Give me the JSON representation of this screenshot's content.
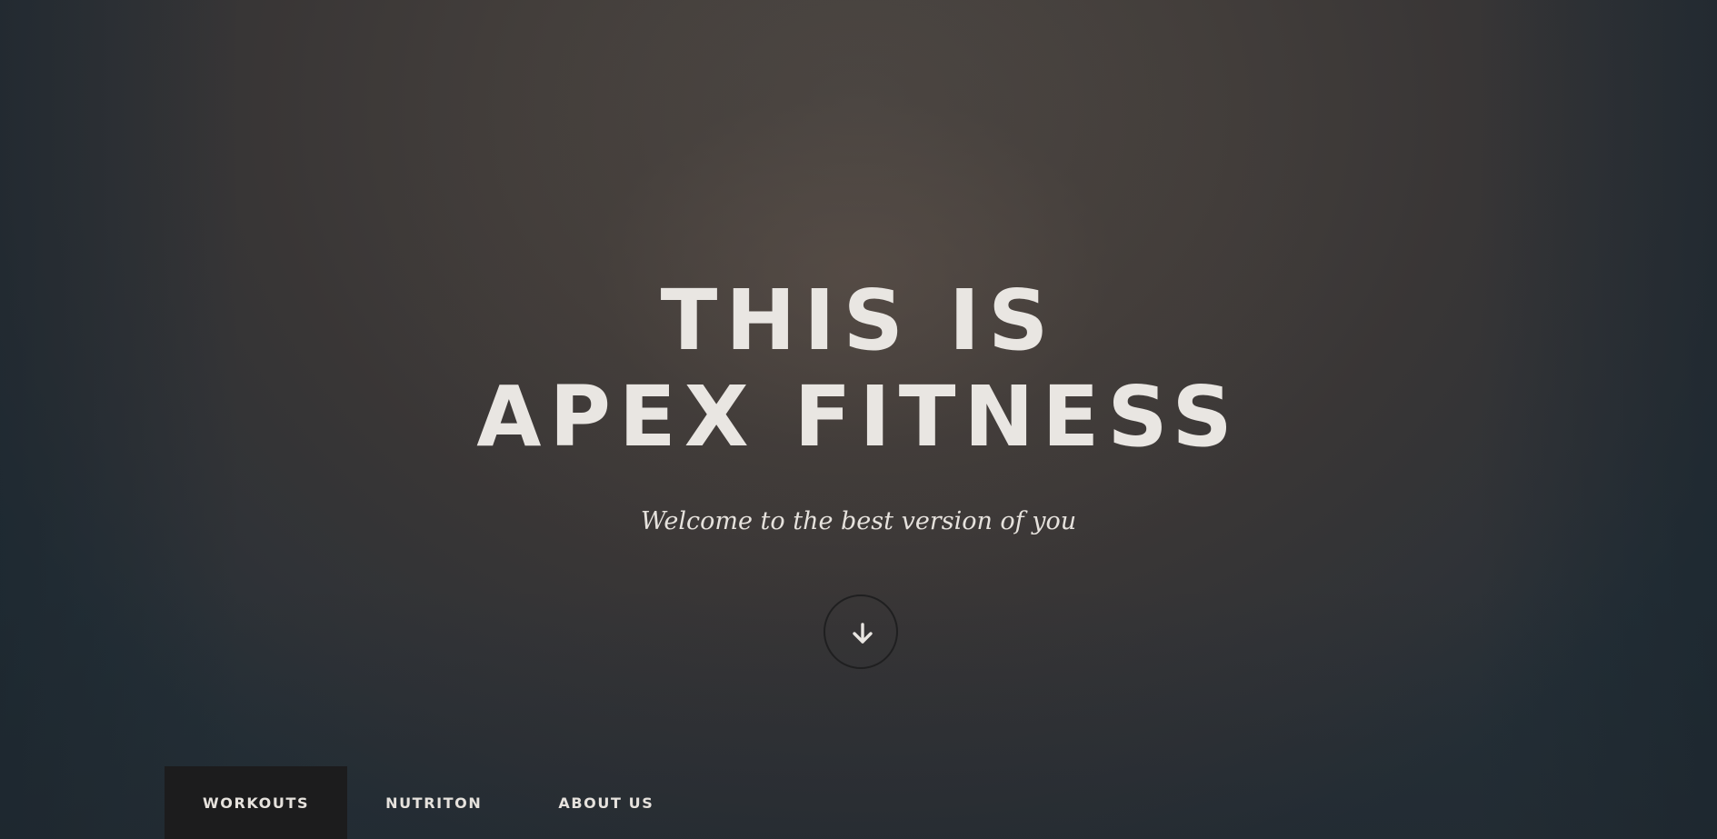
{
  "hero": {
    "title_line_1": "THIS IS",
    "title_line_2": "APEX FITNESS",
    "tagline": "Welcome to the best version of you",
    "scroll_icon": "arrow-down-icon"
  },
  "nav": {
    "items": [
      {
        "label": "WORKOUTS",
        "active": true
      },
      {
        "label": "NUTRITON",
        "active": false
      },
      {
        "label": "ABOUT US",
        "active": false
      }
    ]
  },
  "colors": {
    "text": "#e9e6e2",
    "nav_active_bg": "#1c1c1d",
    "background_center": "#4d4844",
    "background_edge": "#243038"
  }
}
